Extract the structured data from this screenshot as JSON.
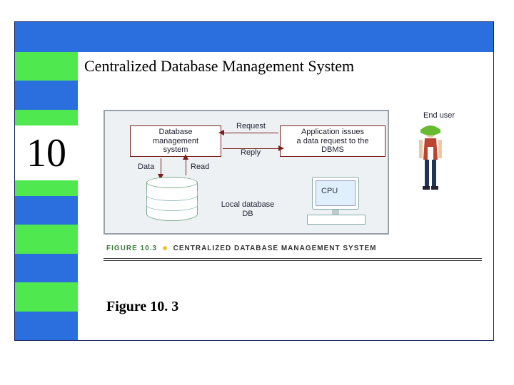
{
  "chapter_number": "10",
  "title": "Centralized Database Management System",
  "caption": "Figure 10. 3",
  "fig_caption_num": "FIGURE 10.3",
  "fig_caption_title": "CENTRALIZED DATABASE MANAGEMENT SYSTEM",
  "boxes": {
    "dbms": "Database\nmanagement\nsystem",
    "app": "Application issues\na data request to the\nDBMS"
  },
  "arrow_labels": {
    "request": "Request",
    "reply": "Reply",
    "data": "Data",
    "read": "Read"
  },
  "db_label": "Local database\nDB",
  "cpu_label": "CPU",
  "end_user": "End user",
  "colors": {
    "blue": "#2a6fdd",
    "green": "#4fe84f",
    "box_border": "#7a1f1f"
  }
}
